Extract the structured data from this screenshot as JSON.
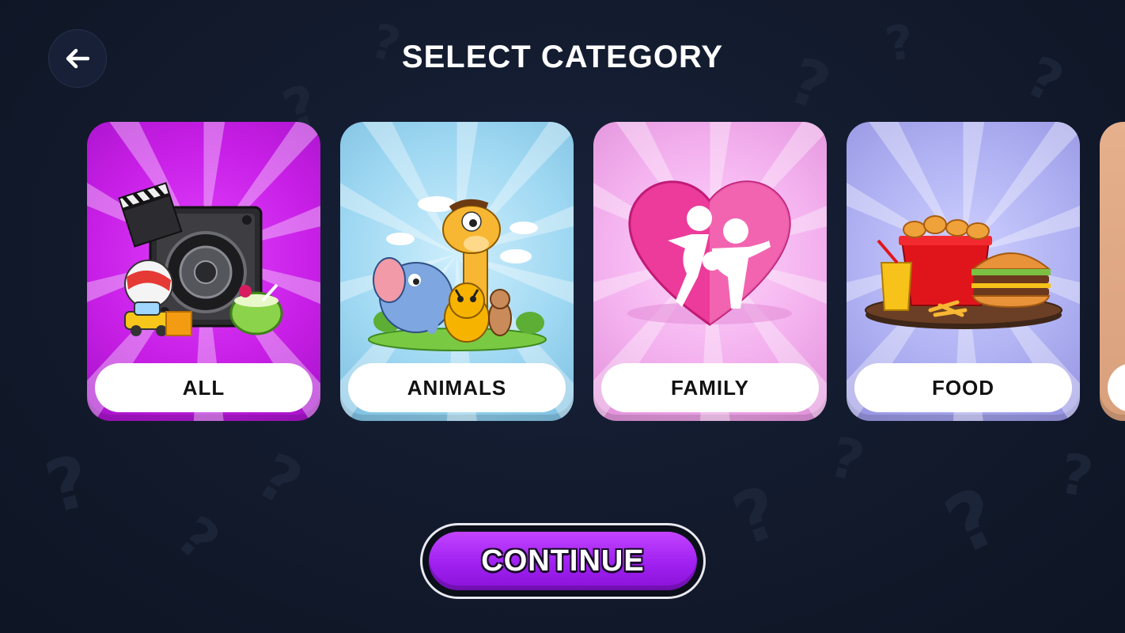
{
  "header": {
    "title": "SELECT CATEGORY",
    "back_icon": "arrow-left-icon"
  },
  "categories": [
    {
      "label": "ALL",
      "icon": "all-category-illustration",
      "color": "#c81fe6"
    },
    {
      "label": "ANIMALS",
      "icon": "animals-category-illustration",
      "color": "#8fd0ee"
    },
    {
      "label": "FAMILY",
      "icon": "family-category-illustration",
      "color": "#f0a2ea"
    },
    {
      "label": "FOOD",
      "icon": "food-category-illustration",
      "color": "#a7a6ee"
    },
    {
      "label": "",
      "icon": "partial-next-card",
      "color": "#d9a07c"
    }
  ],
  "footer": {
    "continue_label": "CONTINUE"
  },
  "colors": {
    "background": "#121a2c",
    "accent": "#a020f0",
    "label_bg": "#ffffff"
  }
}
